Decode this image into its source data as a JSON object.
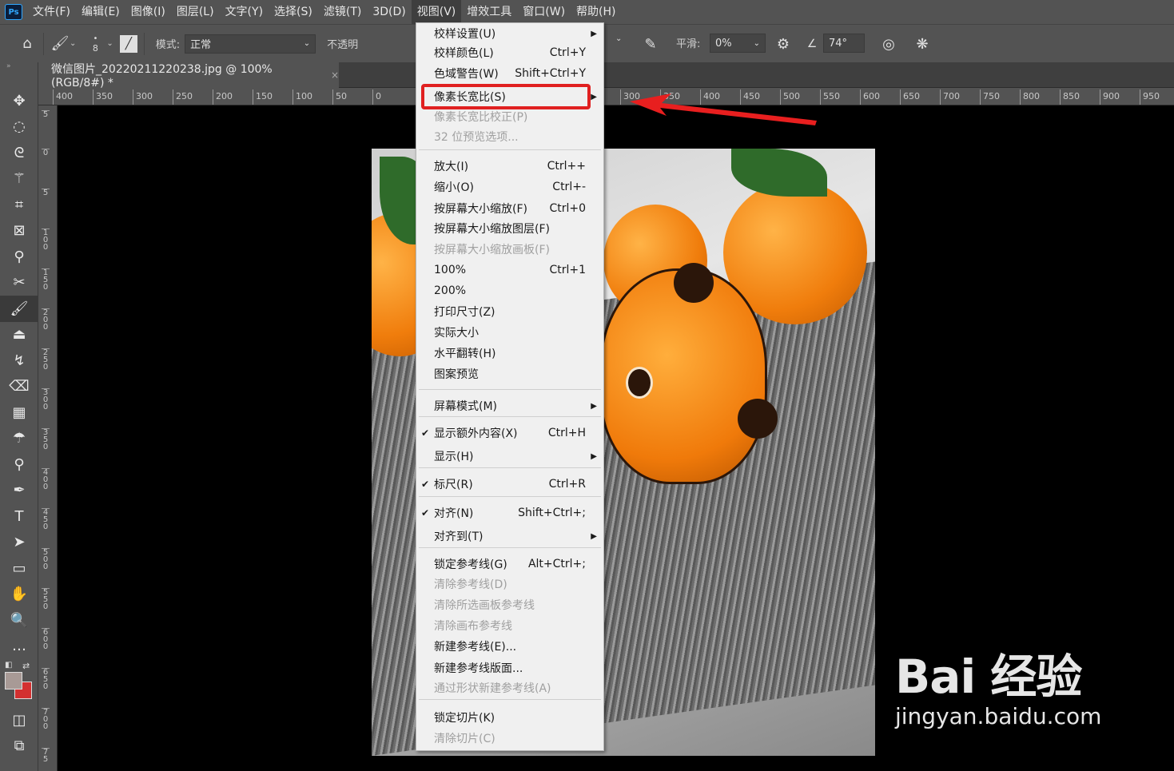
{
  "menubar": {
    "logo": "Ps",
    "items": [
      "文件(F)",
      "编辑(E)",
      "图像(I)",
      "图层(L)",
      "文字(Y)",
      "选择(S)",
      "滤镜(T)",
      "3D(D)",
      "视图(V)",
      "增效工具",
      "窗口(W)",
      "帮助(H)"
    ],
    "active_item": "视图(V)"
  },
  "options_bar": {
    "brush_size": "8",
    "mode_label": "模式:",
    "mode_value": "正常",
    "opacity_label": "不透明",
    "smoothing_label": "平滑:",
    "smoothing_value": "0%",
    "angle_value": "74°"
  },
  "document_tab": {
    "title": "微信图片_20220211220238.jpg @ 100%(RGB/8#) *",
    "close": "×"
  },
  "ruler": {
    "h_ticks": [
      "400",
      "350",
      "300",
      "250",
      "200",
      "150",
      "100",
      "50",
      "0",
      "300",
      "350",
      "400",
      "450",
      "500",
      "550",
      "600",
      "650",
      "700",
      "750",
      "800",
      "850",
      "900",
      "950"
    ],
    "v_ticks": [
      "5",
      "0",
      "5",
      "1\n0\n0",
      "1\n5\n0",
      "2\n0\n0",
      "2\n5\n0",
      "3\n0\n0",
      "3\n5\n0",
      "4\n0\n0",
      "4\n5\n0",
      "5\n0\n0",
      "5\n5\n0",
      "6\n0\n0",
      "6\n5\n0",
      "7\n0\n0",
      "7\n5"
    ]
  },
  "view_menu": {
    "items": [
      {
        "label": "校样设置(U)",
        "shortcut": "",
        "submenu": true,
        "disabled": false,
        "checked": false
      },
      {
        "label": "校样颜色(L)",
        "shortcut": "Ctrl+Y",
        "submenu": false,
        "disabled": false,
        "checked": false
      },
      {
        "label": "色域警告(W)",
        "shortcut": "Shift+Ctrl+Y",
        "submenu": false,
        "disabled": false,
        "checked": false
      },
      {
        "label": "像素长宽比(S)",
        "shortcut": "",
        "submenu": true,
        "disabled": false,
        "checked": false
      },
      {
        "label": "像素长宽比校正(P)",
        "shortcut": "",
        "submenu": false,
        "disabled": true,
        "checked": false
      },
      {
        "label": "32 位预览选项...",
        "shortcut": "",
        "submenu": false,
        "disabled": true,
        "checked": false
      },
      {
        "label": "放大(I)",
        "shortcut": "Ctrl++",
        "submenu": false,
        "disabled": false,
        "checked": false
      },
      {
        "label": "缩小(O)",
        "shortcut": "Ctrl+-",
        "submenu": false,
        "disabled": false,
        "checked": false
      },
      {
        "label": "按屏幕大小缩放(F)",
        "shortcut": "Ctrl+0",
        "submenu": false,
        "disabled": false,
        "checked": false
      },
      {
        "label": "按屏幕大小缩放图层(F)",
        "shortcut": "",
        "submenu": false,
        "disabled": false,
        "checked": false
      },
      {
        "label": "按屏幕大小缩放画板(F)",
        "shortcut": "",
        "submenu": false,
        "disabled": true,
        "checked": false
      },
      {
        "label": "100%",
        "shortcut": "Ctrl+1",
        "submenu": false,
        "disabled": false,
        "checked": false
      },
      {
        "label": "200%",
        "shortcut": "",
        "submenu": false,
        "disabled": false,
        "checked": false
      },
      {
        "label": "打印尺寸(Z)",
        "shortcut": "",
        "submenu": false,
        "disabled": false,
        "checked": false
      },
      {
        "label": "实际大小",
        "shortcut": "",
        "submenu": false,
        "disabled": false,
        "checked": false
      },
      {
        "label": "水平翻转(H)",
        "shortcut": "",
        "submenu": false,
        "disabled": false,
        "checked": false
      },
      {
        "label": "图案预览",
        "shortcut": "",
        "submenu": false,
        "disabled": false,
        "checked": false
      },
      {
        "label": "屏幕模式(M)",
        "shortcut": "",
        "submenu": true,
        "disabled": false,
        "checked": false
      },
      {
        "label": "显示额外内容(X)",
        "shortcut": "Ctrl+H",
        "submenu": false,
        "disabled": false,
        "checked": true
      },
      {
        "label": "显示(H)",
        "shortcut": "",
        "submenu": true,
        "disabled": false,
        "checked": false
      },
      {
        "label": "标尺(R)",
        "shortcut": "Ctrl+R",
        "submenu": false,
        "disabled": false,
        "checked": true
      },
      {
        "label": "对齐(N)",
        "shortcut": "Shift+Ctrl+;",
        "submenu": false,
        "disabled": false,
        "checked": true
      },
      {
        "label": "对齐到(T)",
        "shortcut": "",
        "submenu": true,
        "disabled": false,
        "checked": false
      },
      {
        "label": "锁定参考线(G)",
        "shortcut": "Alt+Ctrl+;",
        "submenu": false,
        "disabled": false,
        "checked": false
      },
      {
        "label": "清除参考线(D)",
        "shortcut": "",
        "submenu": false,
        "disabled": true,
        "checked": false
      },
      {
        "label": "清除所选画板参考线",
        "shortcut": "",
        "submenu": false,
        "disabled": true,
        "checked": false
      },
      {
        "label": "清除画布参考线",
        "shortcut": "",
        "submenu": false,
        "disabled": true,
        "checked": false
      },
      {
        "label": "新建参考线(E)...",
        "shortcut": "",
        "submenu": false,
        "disabled": false,
        "checked": false
      },
      {
        "label": "新建参考线版面...",
        "shortcut": "",
        "submenu": false,
        "disabled": false,
        "checked": false
      },
      {
        "label": "通过形状新建参考线(A)",
        "shortcut": "",
        "submenu": false,
        "disabled": true,
        "checked": false
      },
      {
        "label": "锁定切片(K)",
        "shortcut": "",
        "submenu": false,
        "disabled": false,
        "checked": false
      },
      {
        "label": "清除切片(C)",
        "shortcut": "",
        "submenu": false,
        "disabled": true,
        "checked": false
      }
    ],
    "highlighted_item": "像素长宽比(S)"
  },
  "watermark": {
    "logo": "Bai 经验",
    "url": "jingyan.baidu.com"
  },
  "colors": {
    "panel": "#535353",
    "menu_bg": "#f0f0f0",
    "highlight": "#e02020",
    "foreground_swatch": "#a89a96",
    "background_swatch": "#d33030"
  }
}
